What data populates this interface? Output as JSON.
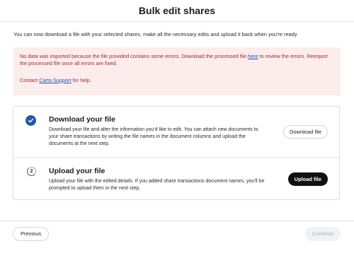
{
  "header": {
    "title": "Bulk edit shares"
  },
  "intro": {
    "text": "You can now download a file with your selected shares, make all the necessary edits and upload it back when you're ready."
  },
  "alert": {
    "text_before_link": "No data was imported because the file provided contains some errors. Download the processed file ",
    "link_label": "here",
    "text_after_link": " to review the errors. Reimport the processed file once all errors are fixed.",
    "contact_prefix": "Contact ",
    "contact_link": "Carta Support",
    "contact_suffix": " for help."
  },
  "steps": [
    {
      "status": "complete",
      "title": "Download your file",
      "description": "Download your file and alter the information you'd like to edit. You can attach new documents to your share transactions by writing the file names in the document columns and upload the documents at the next step.",
      "button_label": "Download file"
    },
    {
      "status": "current",
      "number": "2",
      "title": "Upload your file",
      "description": "Upload your file with the edited details. If you added share transactions document names, you'll be prompted to upload them in the next step.",
      "button_label": "Upload file"
    }
  ],
  "footer": {
    "previous_label": "Previous",
    "continue_label": "Continue",
    "continue_disabled": true
  },
  "colors": {
    "accent": "#2457a8",
    "error_text": "#9b2c2c",
    "error_bg": "#fcecec",
    "primary_button": "#111111"
  },
  "icons": {
    "step1": "checkmark-icon",
    "step2": "step-number-icon"
  }
}
